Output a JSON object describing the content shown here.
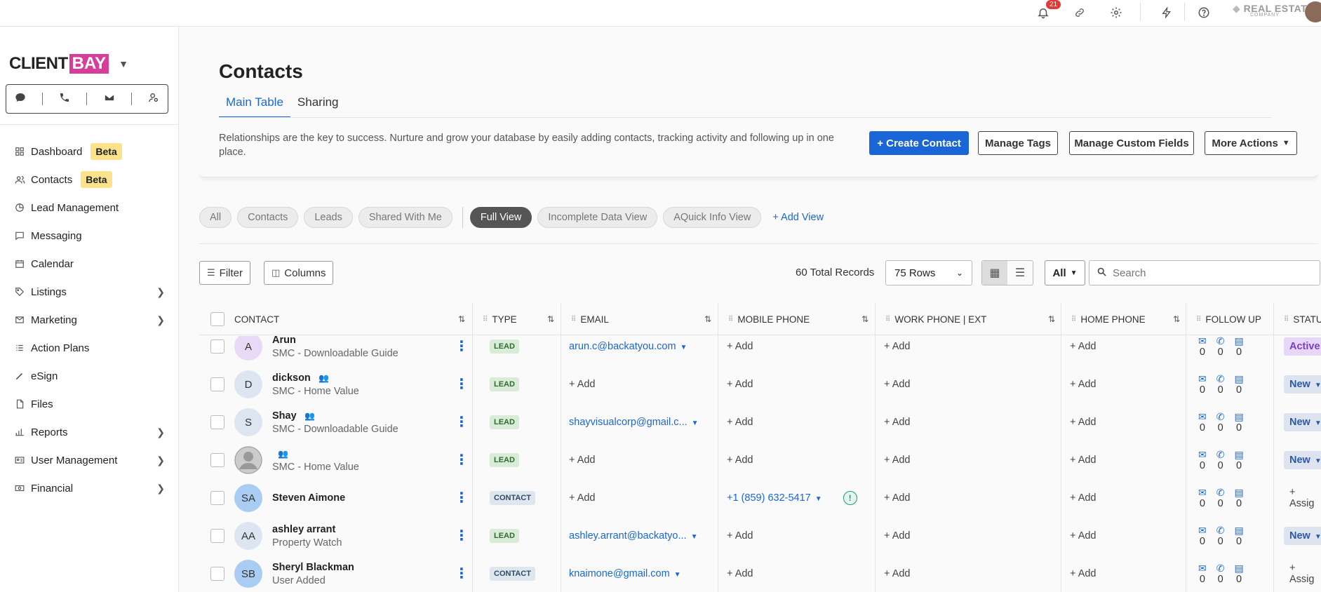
{
  "topbar": {
    "notification_count": "21",
    "brand_name": "REAL ESTATE",
    "brand_sub": "COMPANY",
    "icons": [
      "bell-icon",
      "link-icon",
      "gear-icon",
      "lightning-icon",
      "help-icon"
    ]
  },
  "sidebar": {
    "logo_client": "CLIENT",
    "logo_bay": "BAY",
    "quick_actions": [
      "chat-icon",
      "phone-icon",
      "mail-icon",
      "user-settings-icon"
    ],
    "items": [
      {
        "label": "Dashboard",
        "badge": "Beta",
        "icon": "grid-icon"
      },
      {
        "label": "Contacts",
        "badge": "Beta",
        "icon": "people-icon"
      },
      {
        "label": "Lead Management",
        "icon": "pie-icon"
      },
      {
        "label": "Messaging",
        "icon": "message-icon"
      },
      {
        "label": "Calendar",
        "icon": "calendar-icon"
      },
      {
        "label": "Listings",
        "icon": "tag-icon",
        "has_children": true
      },
      {
        "label": "Marketing",
        "icon": "mail-open-icon",
        "has_children": true
      },
      {
        "label": "Action Plans",
        "icon": "list-icon"
      },
      {
        "label": "eSign",
        "icon": "pen-icon"
      },
      {
        "label": "Files",
        "icon": "file-icon"
      },
      {
        "label": "Reports",
        "icon": "bar-chart-icon",
        "has_children": true
      },
      {
        "label": "User Management",
        "icon": "id-card-icon",
        "has_children": true
      },
      {
        "label": "Financial",
        "icon": "money-icon",
        "has_children": true
      }
    ]
  },
  "page": {
    "title": "Contacts",
    "tabs": [
      {
        "label": "Main Table",
        "active": true
      },
      {
        "label": "Sharing"
      }
    ],
    "description": "Relationships are the key to success. Nurture and grow your database by easily adding contacts, tracking activity and following up in one place.",
    "buttons": {
      "create": "+ Create Contact",
      "manage_tags": "Manage Tags",
      "manage_fields": "Manage Custom Fields",
      "more_actions": "More Actions"
    },
    "views": [
      "All",
      "Contacts",
      "Leads",
      "Shared With Me"
    ],
    "display_views": [
      "Full View",
      "Incomplete Data View",
      "AQuick Info View"
    ],
    "add_view": "+ Add View"
  },
  "toolbar": {
    "filter": "Filter",
    "columns": "Columns",
    "total_records": "60 Total Records",
    "rows": "75 Rows",
    "scope": "All",
    "search_placeholder": "Search"
  },
  "table": {
    "headers": [
      "Contact",
      "Type",
      "Email",
      "Mobile Phone",
      "Work Phone | Ext",
      "Home Phone",
      "Follow Up",
      "Statu"
    ],
    "add_label": "+ Add",
    "rows": [
      {
        "initials": "A",
        "name": "Arun",
        "source": "SMC - Downloadable Guide",
        "type": "LEAD",
        "email": "arun.c@backatyou.com",
        "mobile": "",
        "status": "Active",
        "shared": false
      },
      {
        "initials": "D",
        "name": "dickson",
        "source": "SMC - Home Value",
        "type": "LEAD",
        "email": "",
        "mobile": "",
        "status": "New",
        "shared": true
      },
      {
        "initials": "S",
        "name": "Shay",
        "source": "SMC - Downloadable Guide",
        "type": "LEAD",
        "email": "shayvisualcorp@gmail.c...",
        "mobile": "",
        "status": "New",
        "shared": true
      },
      {
        "initials": "",
        "name": "",
        "source": "SMC - Home Value",
        "type": "LEAD",
        "email": "",
        "mobile": "",
        "status": "New",
        "shared": true
      },
      {
        "initials": "SA",
        "name": "Steven Aimone",
        "source": "",
        "type": "CONTACT",
        "email": "",
        "mobile": "+1 (859) 632-5417",
        "status": "+ Assig",
        "shared": false
      },
      {
        "initials": "AA",
        "name": "ashley arrant",
        "source": "Property Watch",
        "type": "LEAD",
        "email": "ashley.arrant@backatyo...",
        "mobile": "",
        "status": "New",
        "shared": false
      },
      {
        "initials": "SB",
        "name": "Sheryl Blackman",
        "source": "User Added",
        "type": "CONTACT",
        "email": "knaimone@gmail.com",
        "mobile": "",
        "status": "+ Assig",
        "shared": false
      }
    ],
    "follow_up_counts": [
      "0",
      "0",
      "0"
    ]
  },
  "colors": {
    "accent": "#1a66d6",
    "beta_badge": "#fbe28b",
    "logo_pink": "#d63e9a",
    "status_active": "#7b3fc4",
    "status_new": "#2d5aa5"
  }
}
